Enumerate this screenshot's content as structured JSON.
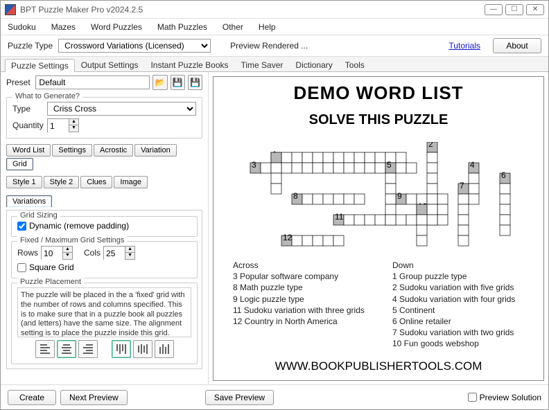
{
  "window": {
    "title": "BPT Puzzle Maker Pro v2024.2.5"
  },
  "menu": {
    "sudoku": "Sudoku",
    "mazes": "Mazes",
    "wordpuzzles": "Word Puzzles",
    "mathpuzzles": "Math Puzzles",
    "other": "Other",
    "help": "Help"
  },
  "toolbar": {
    "puzzle_type_label": "Puzzle Type",
    "puzzle_type_value": "Crossword Variations (Licensed)",
    "preview_status": "Preview Rendered ...",
    "tutorials": "Tutorials",
    "about": "About"
  },
  "main_tabs": [
    "Puzzle Settings",
    "Output Settings",
    "Instant Puzzle Books",
    "Time Saver",
    "Dictionary",
    "Tools"
  ],
  "preset": {
    "label": "Preset",
    "value": "Default"
  },
  "generate": {
    "legend": "What to Generate?",
    "type_label": "Type",
    "type_value": "Criss Cross",
    "quantity_label": "Quantity",
    "quantity_value": "1"
  },
  "subtabs1": [
    "Word List",
    "Settings",
    "Acrostic",
    "Variation",
    "Grid"
  ],
  "subtabs2": [
    "Style 1",
    "Style 2",
    "Clues",
    "Image"
  ],
  "variations_tab": "Variations",
  "grid_sizing": {
    "legend": "Grid Sizing",
    "dynamic_label": "Dynamic (remove padding)",
    "dynamic_checked": true
  },
  "fixed_grid": {
    "legend": "Fixed / Maximum Grid Settings",
    "rows_label": "Rows",
    "rows_value": "10",
    "cols_label": "Cols",
    "cols_value": "25",
    "square_label": "Square Grid"
  },
  "placement": {
    "legend": "Puzzle Placement",
    "desc": "The puzzle will be placed in the a 'fixed' grid with the number of rows and columns specified. This is to make sure that in a puzzle book all puzzles (and letters) have the same size. The alignment setting is to place the puzzle inside this grid."
  },
  "bottom": {
    "create": "Create",
    "next_preview": "Next Preview",
    "save_preview": "Save Preview",
    "preview_solution": "Preview Solution"
  },
  "preview": {
    "title": "DEMO WORD LIST",
    "subtitle": "SOLVE THIS PUZZLE",
    "footer": "WWW.BOOKPUBLISHERTOOLS.COM",
    "across": {
      "heading": "Across",
      "items": [
        "3 Popular software company",
        "8 Math puzzle type",
        "9 Logic puzzle type",
        "11 Sudoku variation with three grids",
        "12 Country in North America"
      ]
    },
    "down": {
      "heading": "Down",
      "items": [
        "1 Group puzzle type",
        "2 Sudoku variation with five grids",
        "4 Sudoku variation with four grids",
        "5 Continent",
        "6 Online retailer",
        "7 Sudoku variation with two grids",
        "10 Fun goods webshop"
      ]
    }
  }
}
